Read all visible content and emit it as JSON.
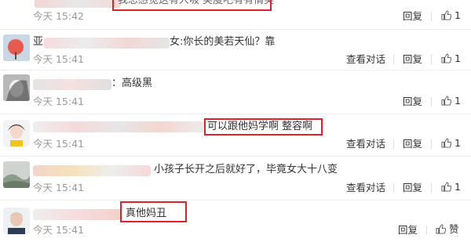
{
  "colors": {
    "highlight_box": "#e0202a",
    "time_text": "#999999",
    "divider": "#ececec"
  },
  "comments": [
    {
      "partial_text": "我总感觉这有人吸 美度吧有有情美",
      "time": "今天 15:42",
      "show_dialog": false,
      "reply": "回复",
      "like": "1"
    },
    {
      "prefix": "亚",
      "suffix": "女:你长的美若天仙？靠",
      "time": "今天 15:41",
      "dialog": "查看对话",
      "reply": "回复",
      "like": "1"
    },
    {
      "text": "：高级黑",
      "time": "今天 15:41",
      "reply": "回复",
      "like": "1"
    },
    {
      "text": "可以跟他妈学啊  整容啊",
      "time": "今天 15:41",
      "dialog": "查看对话",
      "reply": "回复",
      "like": "1"
    },
    {
      "text": "小孩子长开之后就好了，毕竟女大十八变",
      "time": "今天 15:41",
      "dialog": "查看对话",
      "reply": "回复",
      "like": "1"
    },
    {
      "text": "真他妈丑",
      "time": "今天 15:41",
      "reply": "回复",
      "like": "赞"
    }
  ]
}
